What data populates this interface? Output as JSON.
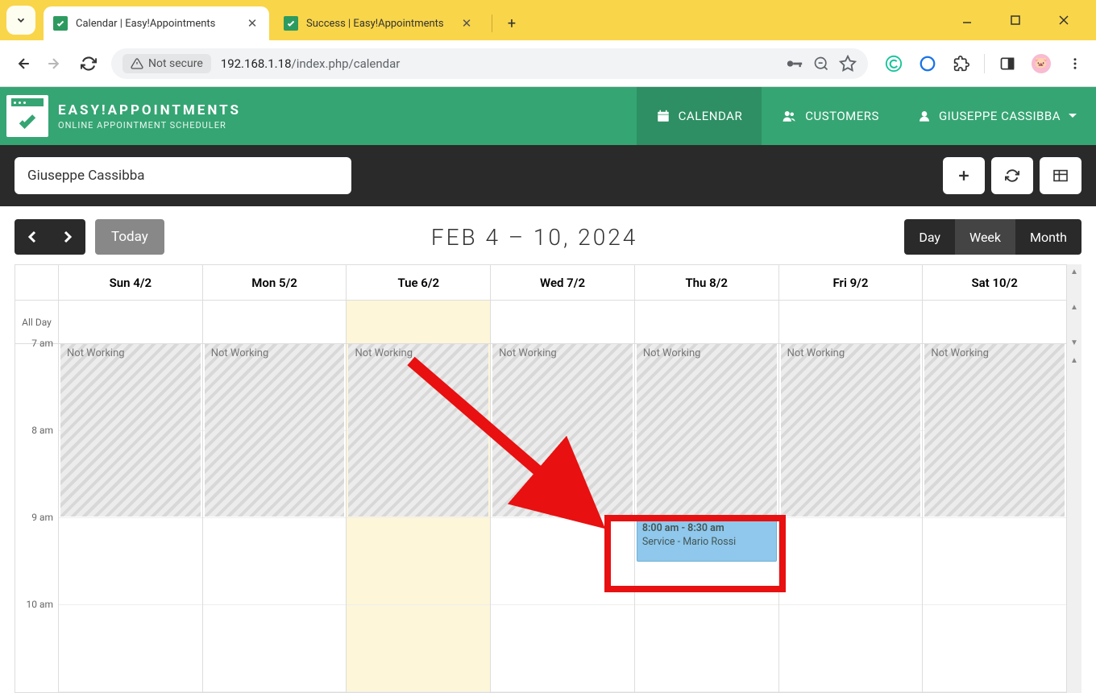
{
  "browser": {
    "tabs": [
      {
        "title": "Calendar | Easy!Appointments",
        "active": true
      },
      {
        "title": "Success | Easy!Appointments",
        "active": false
      }
    ],
    "not_secure": "Not secure",
    "url_host": "192.168.1.18",
    "url_path": "/index.php/calendar"
  },
  "app": {
    "title": "EASY!APPOINTMENTS",
    "subtitle": "ONLINE APPOINTMENT SCHEDULER",
    "nav": {
      "calendar": "CALENDAR",
      "customers": "CUSTOMERS",
      "user": "GIUSEPPE CASSIBBA"
    }
  },
  "toolbar": {
    "provider": "Giuseppe Cassibba"
  },
  "calendar": {
    "today_label": "Today",
    "title": "FEB 4 – 10, 2024",
    "views": {
      "day": "Day",
      "week": "Week",
      "month": "Month"
    },
    "day_headers": [
      "Sun 4/2",
      "Mon 5/2",
      "Tue 6/2",
      "Wed 7/2",
      "Thu 8/2",
      "Fri 9/2",
      "Sat 10/2"
    ],
    "allday_label": "All Day",
    "time_slots": [
      "7 am",
      "8 am",
      "9 am",
      "10 am"
    ],
    "not_working_label": "Not Working",
    "appointment": {
      "time": "8:00 am - 8:30 am",
      "label": "Service - Mario Rossi"
    },
    "today_index": 2
  }
}
